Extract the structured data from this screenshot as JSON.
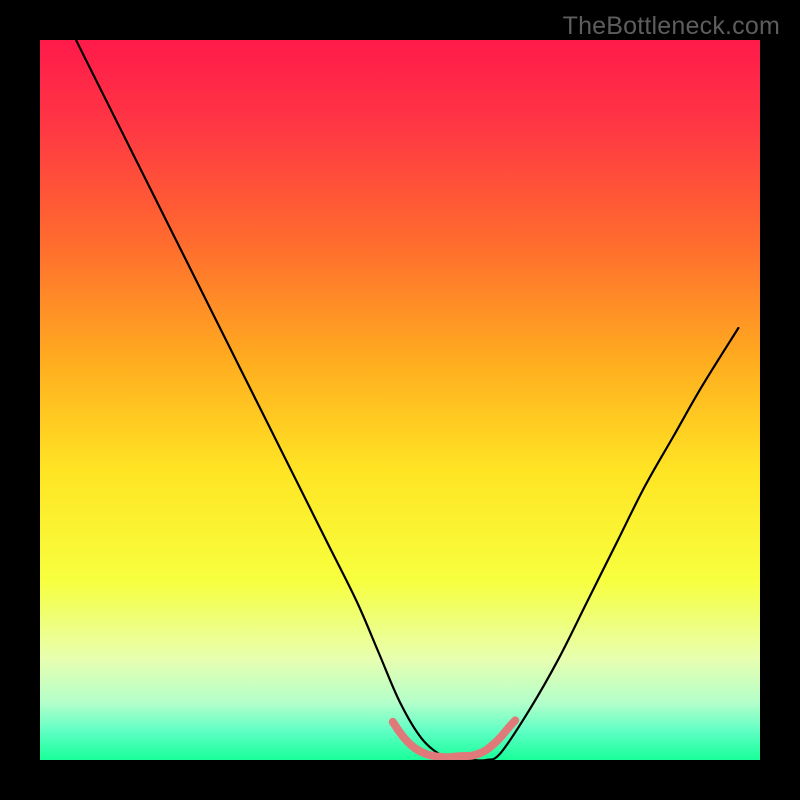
{
  "watermark": "TheBottleneck.com",
  "chart_data": {
    "type": "line",
    "title": "",
    "xlabel": "",
    "ylabel": "",
    "xlim": [
      0,
      100
    ],
    "ylim": [
      0,
      100
    ],
    "grid": false,
    "legend": false,
    "gradient_stops": [
      {
        "offset": 0,
        "color": "#ff1a4a"
      },
      {
        "offset": 12,
        "color": "#ff3744"
      },
      {
        "offset": 28,
        "color": "#ff6b2e"
      },
      {
        "offset": 45,
        "color": "#ffae1f"
      },
      {
        "offset": 60,
        "color": "#ffe524"
      },
      {
        "offset": 75,
        "color": "#f7ff3e"
      },
      {
        "offset": 86,
        "color": "#e7ffb0"
      },
      {
        "offset": 92,
        "color": "#b4ffca"
      },
      {
        "offset": 96,
        "color": "#5fffc4"
      },
      {
        "offset": 100,
        "color": "#18ff99"
      }
    ],
    "series": [
      {
        "name": "curve",
        "stroke": "#000000",
        "width": 2.2,
        "x": [
          5,
          8,
          12,
          16,
          20,
          24,
          28,
          32,
          36,
          40,
          44,
          47,
          50,
          53,
          56,
          58,
          60,
          62,
          64,
          68,
          72,
          76,
          80,
          84,
          88,
          92,
          97
        ],
        "y": [
          100,
          94,
          86,
          78,
          70,
          62,
          54,
          46,
          38,
          30,
          22,
          15,
          8,
          3,
          0.5,
          0,
          0,
          0,
          1,
          7,
          14,
          22,
          30,
          38,
          45,
          52,
          60
        ]
      },
      {
        "name": "bottom-marker",
        "stroke": "#e07a7a",
        "width": 8,
        "linecap": "round",
        "x": [
          49,
          50,
          51,
          52,
          53,
          54,
          55,
          56,
          57,
          58,
          59,
          60,
          61,
          62,
          63,
          64,
          65,
          66
        ],
        "y": [
          5.3,
          3.8,
          2.6,
          1.7,
          1.1,
          0.7,
          0.5,
          0.4,
          0.4,
          0.5,
          0.55,
          0.6,
          0.9,
          1.4,
          2.2,
          3.2,
          4.4,
          5.5
        ]
      }
    ]
  }
}
